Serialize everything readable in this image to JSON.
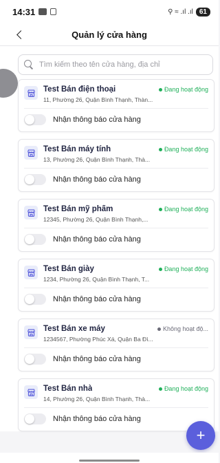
{
  "status_bar": {
    "time": "14:31",
    "icons_right": "⚲ ≈ .ıl .ıl",
    "battery": "61"
  },
  "header": {
    "title": "Quản lý cửa hàng",
    "back_icon": "chevron-left-icon"
  },
  "search": {
    "placeholder": "Tìm kiếm theo tên cửa hàng, địa chỉ",
    "value": ""
  },
  "notify_label": "Nhận thông báo cửa hàng",
  "colors": {
    "accent": "#5b5fdc",
    "active": "#20b05a",
    "inactive": "#6b6b78"
  },
  "stores": [
    {
      "name": "Test Bán điện thoại",
      "address": "11, Phường 26, Quận Bình Thạnh, Thàn...",
      "status": "Đang hoạt động",
      "status_color": "#20b05a",
      "notify": false
    },
    {
      "name": "Test Bán máy tính",
      "address": "13, Phường 26, Quận Bình Thạnh, Thà...",
      "status": "Đang hoạt động",
      "status_color": "#20b05a",
      "notify": false
    },
    {
      "name": "Test Bán mỹ phẩm",
      "address": "12345, Phường 26, Quận Bình Thạnh,...",
      "status": "Đang hoạt động",
      "status_color": "#20b05a",
      "notify": false
    },
    {
      "name": "Test Bán giày",
      "address": "1234, Phường 26, Quận Bình Thạnh, T...",
      "status": "Đang hoạt động",
      "status_color": "#20b05a",
      "notify": false
    },
    {
      "name": "Test Bán xe máy",
      "address": "1234567, Phường Phúc Xá, Quận Ba Đì...",
      "status": "Không hoạt độ...",
      "status_color": "#6b6b78",
      "notify": false
    },
    {
      "name": "Test Bán nhà",
      "address": "14, Phường 26, Quận Bình Thạnh, Thà...",
      "status": "Đang hoạt động",
      "status_color": "#20b05a",
      "notify": false
    }
  ],
  "fab": {
    "label": "+",
    "icon": "plus-icon"
  }
}
